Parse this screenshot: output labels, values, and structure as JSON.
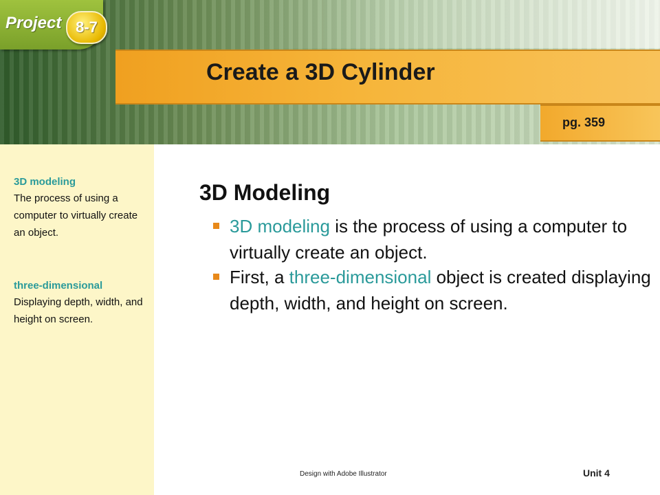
{
  "header": {
    "project_label": "Project",
    "project_number": "8-7",
    "title": "Create a 3D Cylinder",
    "page_ref": "pg. 359"
  },
  "sidebar": {
    "terms": [
      {
        "term": "3D modeling",
        "definition": "The process of using a computer to virtually create an object."
      },
      {
        "term": "three-dimensional",
        "definition": "Displaying depth, width, and height on screen."
      }
    ]
  },
  "main": {
    "heading": "3D Modeling",
    "bullets": [
      {
        "term": "3D modeling",
        "rest": " is the process of using a computer to virtually create an object."
      },
      {
        "pre": "First, a ",
        "term": "three-dimensional",
        "rest": " object is created displaying depth, width, and height on screen."
      }
    ]
  },
  "footer": {
    "course": "Design with Adobe Illustrator",
    "unit": "Unit 4"
  },
  "colors": {
    "accent_teal": "#2a9a9a",
    "title_orange": "#f0a020",
    "project_green": "#8ab034",
    "badge_gold": "#e8b800",
    "sidebar_bg": "#fdf6c8",
    "bullet_orange": "#e8891a"
  }
}
